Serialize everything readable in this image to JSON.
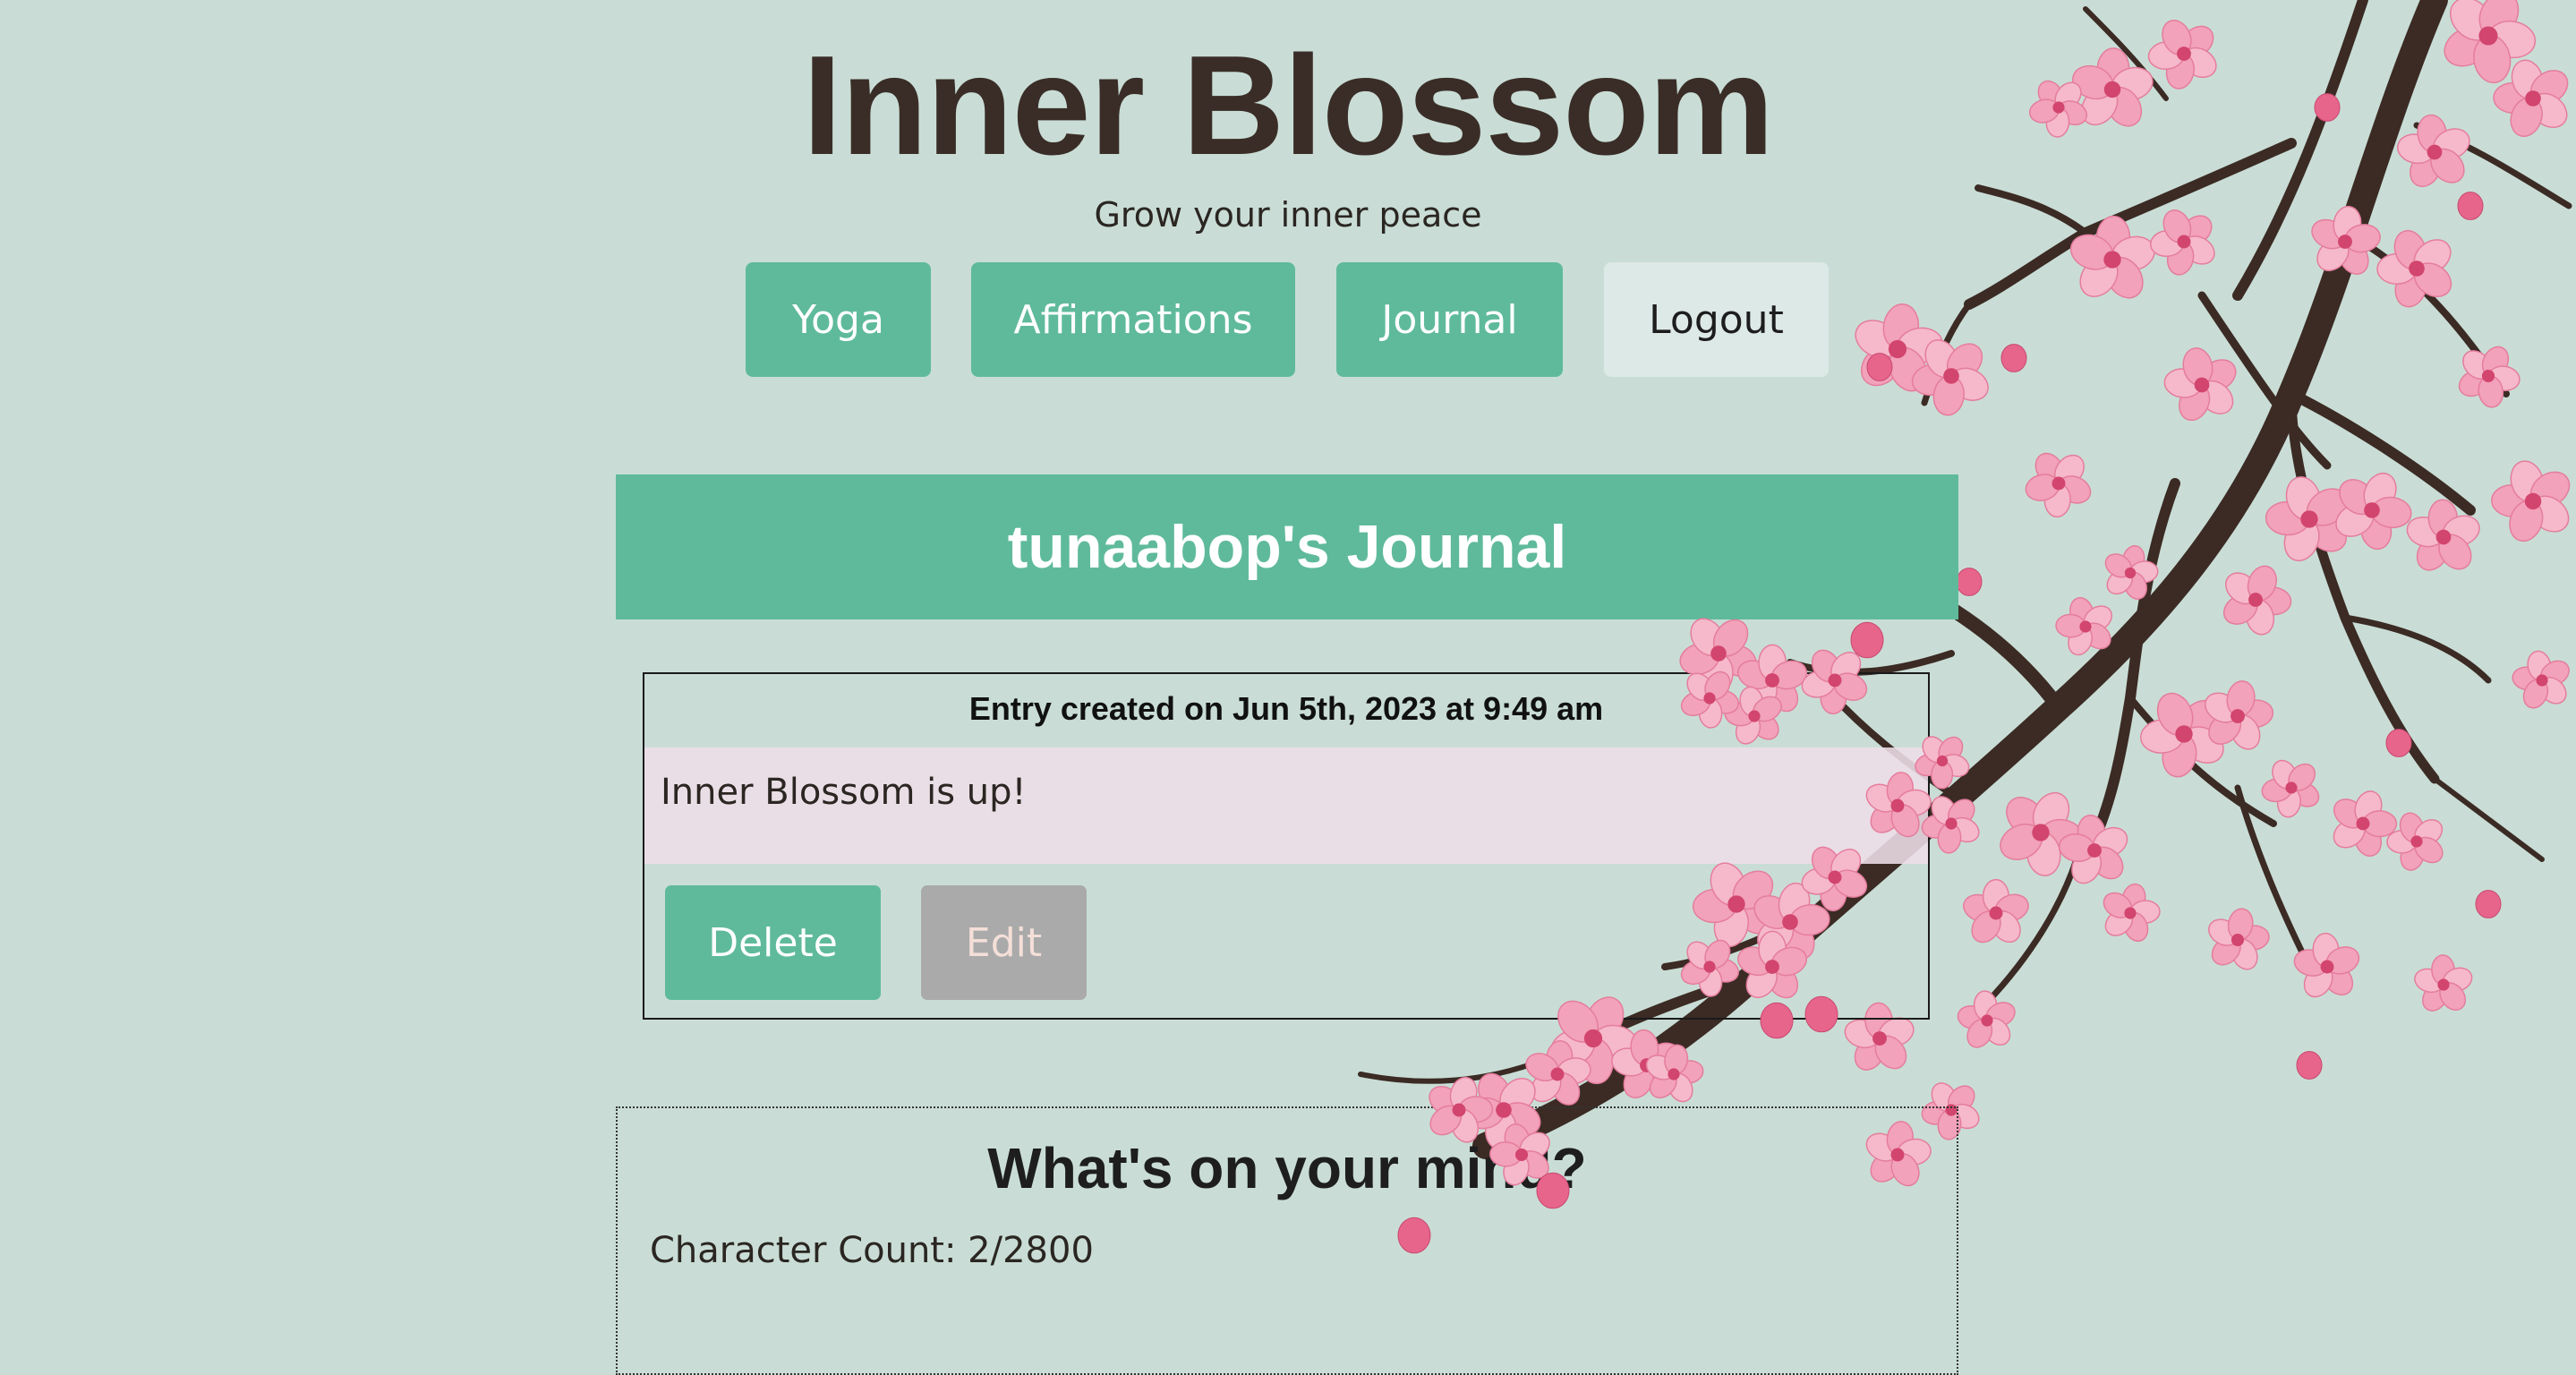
{
  "header": {
    "title": "Inner Blossom",
    "tagline": "Grow your inner peace"
  },
  "nav": {
    "yoga": "Yoga",
    "affirmations": "Affirmations",
    "journal": "Journal",
    "logout": "Logout"
  },
  "journal": {
    "heading": "tunaabop's Journal",
    "entries": [
      {
        "date": "Entry created on Jun 5th, 2023 at 9:49 am",
        "body": "Inner Blossom is up!",
        "delete_label": "Delete",
        "edit_label": "Edit"
      }
    ]
  },
  "new_entry": {
    "prompt": "What's on your mind?",
    "char_count": "Character Count: 2/2800"
  },
  "colors": {
    "background": "#c9ddd6",
    "accent": "#5fba9c",
    "title": "#3a2d27",
    "edit_disabled": "#aaaaaa",
    "logout_bg": "#dde9e6",
    "blossom_pink": "#f2a7bf",
    "branch": "#3b2b24"
  },
  "icons": {
    "decoration": "cherry-blossom-branch"
  }
}
